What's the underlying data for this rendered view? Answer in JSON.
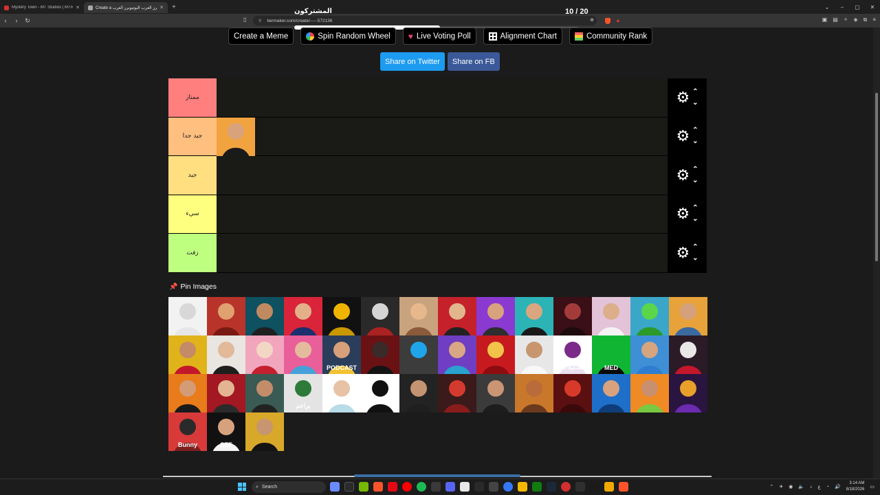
{
  "browser": {
    "tabs": [
      {
        "title": "Mystery Town - MT Studios | MTRP",
        "active": false
      },
      {
        "title": "Create a يوتيوبرز العرب اليوتيوبرز العرب",
        "active": true
      }
    ],
    "new_tab": "+",
    "url": "tiermaker.com/create/-----572136",
    "window_controls": [
      "⌄",
      "–",
      "▢",
      "✕"
    ]
  },
  "overlay": {
    "title": "المشتركون",
    "count": "10 / 20"
  },
  "toolbar": {
    "buttons": [
      {
        "label": "Create a Meme",
        "icon": "none"
      },
      {
        "label": "Spin Random Wheel",
        "icon": "wheel-icon"
      },
      {
        "label": "Live Voting Poll",
        "icon": "heart-icon"
      },
      {
        "label": "Alignment Chart",
        "icon": "grid-icon"
      },
      {
        "label": "Community Rank",
        "icon": "rank-icon"
      }
    ]
  },
  "share": {
    "twitter": "Share on Twitter",
    "facebook": "Share on FB"
  },
  "tiers": [
    {
      "label": "ممتاز",
      "color": "#ff7f7f"
    },
    {
      "label": "جيد جدا",
      "color": "#ffbf7f"
    },
    {
      "label": "جيد",
      "color": "#ffdf7f"
    },
    {
      "label": "سيء",
      "color": "#ffff7f"
    },
    {
      "label": "زفت",
      "color": "#bfff7f"
    }
  ],
  "tier_controls": {
    "gear": "⚙",
    "up": "⌃",
    "down": "⌄"
  },
  "pin_images": "Pin Images",
  "pool_items": [
    {
      "bg": "#f2f2f2",
      "skin": "#d8d8d8",
      "body": "#e6e6e6",
      "label": ""
    },
    {
      "bg": "#b8342a",
      "skin": "#e0a070",
      "body": "#7a1a14",
      "label": ""
    },
    {
      "bg": "#0e5160",
      "skin": "#c08a60",
      "body": "#202020",
      "label": ""
    },
    {
      "bg": "#d9243a",
      "skin": "#e3b08a",
      "body": "#1d2f6f",
      "label": ""
    },
    {
      "bg": "#111111",
      "skin": "#f0b400",
      "body": "#c99700",
      "label": ""
    },
    {
      "bg": "#2a2a2a",
      "skin": "#d5d5d5",
      "body": "#aa2222",
      "label": ""
    },
    {
      "bg": "#c8a37e",
      "skin": "#e8b88d",
      "body": "#8a5a3a",
      "label": ""
    },
    {
      "bg": "#c4212b",
      "skin": "#e2b68d",
      "body": "#222222",
      "label": ""
    },
    {
      "bg": "#8a3ad1",
      "skin": "#d8a27c",
      "body": "#2e2e2e",
      "label": ""
    },
    {
      "bg": "#2cb3b6",
      "skin": "#d9a680",
      "body": "#1a1a1a",
      "label": ""
    },
    {
      "bg": "#3a0f16",
      "skin": "#a43b3b",
      "body": "#1d0b0e",
      "label": ""
    },
    {
      "bg": "#e3c3d8",
      "skin": "#dcae89",
      "body": "#f3f3f3",
      "label": ""
    },
    {
      "bg": "#3aa7c9",
      "skin": "#5bd64a",
      "body": "#2b9a2a",
      "label": ""
    },
    {
      "bg": "#e8a23b",
      "skin": "#d5a07c",
      "body": "#3b6aa0",
      "label": ""
    },
    {
      "bg": "#e0b31a",
      "skin": "#c58a66",
      "body": "#c4172b",
      "label": ""
    },
    {
      "bg": "#e9e6e2",
      "skin": "#e2b999",
      "body": "#1e1e1e",
      "label": ""
    },
    {
      "bg": "#f1a6be",
      "skin": "#f3d7c5",
      "body": "#c4202e",
      "label": ""
    },
    {
      "bg": "#e95f9a",
      "skin": "#e5bb9d",
      "body": "#46a1d8",
      "label": ""
    },
    {
      "bg": "#2a3d5a",
      "skin": "#d79f7a",
      "body": "#f1c232",
      "label": "PODCAST"
    },
    {
      "bg": "#6a1114",
      "skin": "#3a2a2a",
      "body": "#141414",
      "label": ""
    },
    {
      "bg": "#3c3c3c",
      "skin": "#1fa4e9",
      "body": "#3c3c3c",
      "label": ""
    },
    {
      "bg": "#6f3ec2",
      "skin": "#d9a783",
      "body": "#2aa1cf",
      "label": ""
    },
    {
      "bg": "#c71a1f",
      "skin": "#f2c34a",
      "body": "#8c0c10",
      "label": ""
    },
    {
      "bg": "#e7e7e7",
      "skin": "#c7966f",
      "body": "#f8f8f8",
      "label": ""
    },
    {
      "bg": "#ffffff",
      "skin": "#7b2a8a",
      "body": "#e9e0f0",
      "label": "تشكيلات"
    },
    {
      "bg": "#10b534",
      "skin": "#10b534",
      "body": "#0a0a0a",
      "label": "MED"
    },
    {
      "bg": "#3e8fd6",
      "skin": "#d6a47f",
      "body": "#2f7dd0",
      "label": ""
    },
    {
      "bg": "#2b1b27",
      "skin": "#e8e8e8",
      "body": "#c4172b",
      "label": ""
    },
    {
      "bg": "#e87b1a",
      "skin": "#d49b77",
      "body": "#1a1a1a",
      "label": ""
    },
    {
      "bg": "#a31822",
      "skin": "#e4b592",
      "body": "#2b2b2b",
      "label": ""
    },
    {
      "bg": "#3a5b54",
      "skin": "#c38d6a",
      "body": "#222222",
      "label": ""
    },
    {
      "bg": "#e4e4e4",
      "skin": "#2d7a3a",
      "body": "#e4e4e4",
      "label": "براعم"
    },
    {
      "bg": "#ffffff",
      "skin": "#e7c2a6",
      "body": "#b8dbe8",
      "label": ""
    },
    {
      "bg": "#ffffff",
      "skin": "#111111",
      "body": "#111111",
      "label": ""
    },
    {
      "bg": "#232323",
      "skin": "#c49472",
      "body": "#1f1f1f",
      "label": ""
    },
    {
      "bg": "#3a1a1a",
      "skin": "#d33a2e",
      "body": "#8b1c1c",
      "label": ""
    },
    {
      "bg": "#3b3b3b",
      "skin": "#c99574",
      "body": "#1d1d1d",
      "label": ""
    },
    {
      "bg": "#c9772b",
      "skin": "#b96b3a",
      "body": "#6b3a1e",
      "label": ""
    },
    {
      "bg": "#5a1010",
      "skin": "#d83a2a",
      "body": "#3a0a0a",
      "label": ""
    },
    {
      "bg": "#1e6fc9",
      "skin": "#d8a27f",
      "body": "#0f3d7a",
      "label": ""
    },
    {
      "bg": "#f08a24",
      "skin": "#c99070",
      "body": "#7ac943",
      "label": ""
    },
    {
      "bg": "#2a1440",
      "skin": "#e8a02a",
      "body": "#6b2bb0",
      "label": ""
    },
    {
      "bg": "#d83a3a",
      "skin": "#2a2a2a",
      "body": "#7d1e1e",
      "label": "Bunny"
    },
    {
      "bg": "#111111",
      "skin": "#d6a27d",
      "body": "#f3f3f3",
      "label": "SEF"
    },
    {
      "bg": "#d8a82a",
      "skin": "#c7956f",
      "body": "#141414",
      "label": ""
    }
  ],
  "ranked_item": {
    "bg": "#f1a340",
    "skin": "#d8a27c",
    "body": "#1a1a1a"
  },
  "taskbar": {
    "search": "Search",
    "time": "3:14 AM",
    "date": "8/18/2026",
    "lang": "ع"
  }
}
